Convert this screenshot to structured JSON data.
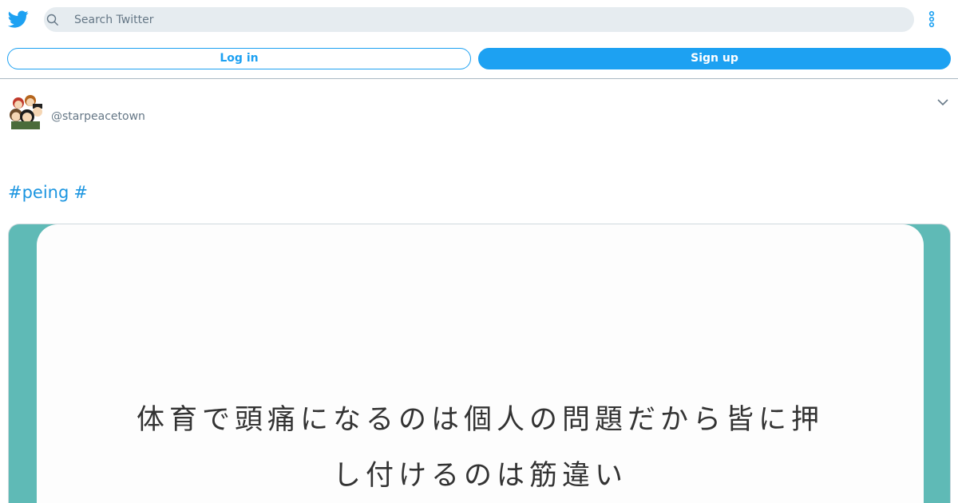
{
  "header": {
    "logo_icon": "twitter-bird-icon",
    "search": {
      "placeholder": "Search Twitter",
      "value": ""
    },
    "more_icon": "vertical-ellipsis-icon"
  },
  "auth": {
    "login_label": "Log in",
    "signup_label": "Sign up"
  },
  "tweet": {
    "avatar_icon": "avatar-illustration",
    "handle": "@starpeacetown",
    "menu_icon": "chevron-down-icon",
    "hashtags": [
      "#peing",
      "#"
    ],
    "media": {
      "line1": "体育で頭痛になるのは個人の問題だから皆に押",
      "line2": "し付けるのは筋違い",
      "border_color": "#5fbab6"
    }
  },
  "colors": {
    "brand": "#1da1f2",
    "link": "#1b95e0",
    "muted": "#657786"
  }
}
